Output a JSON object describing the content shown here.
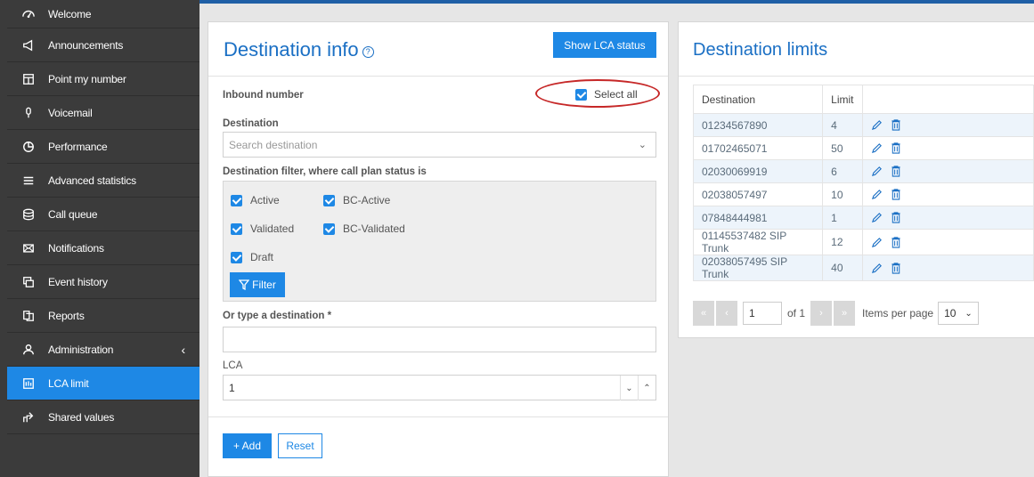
{
  "sidebar": {
    "items": [
      {
        "label": "Welcome",
        "icon": "tachometer-icon"
      },
      {
        "label": "Announcements",
        "icon": "megaphone-icon"
      },
      {
        "label": "Point my number",
        "icon": "layout-icon"
      },
      {
        "label": "Voicemail",
        "icon": "microphone-icon"
      },
      {
        "label": "Performance",
        "icon": "pie-chart-icon"
      },
      {
        "label": "Advanced statistics",
        "icon": "list-icon"
      },
      {
        "label": "Call queue",
        "icon": "database-icon"
      },
      {
        "label": "Notifications",
        "icon": "envelope-icon"
      },
      {
        "label": "Event history",
        "icon": "history-icon"
      },
      {
        "label": "Reports",
        "icon": "documents-icon"
      },
      {
        "label": "Administration",
        "icon": "user-icon"
      },
      {
        "label": "LCA limit",
        "icon": "lca-icon"
      },
      {
        "label": "Shared values",
        "icon": "share-icon"
      }
    ],
    "active_index": 11,
    "accent": "#1e88e5"
  },
  "destination_info": {
    "title": "Destination info",
    "show_lca_label": "Show LCA status",
    "inbound_label": "Inbound number",
    "select_all_label": "Select all",
    "destination_label": "Destination",
    "destination_placeholder": "Search destination",
    "filter_label": "Destination filter, where call plan status is",
    "filters": {
      "active": "Active",
      "bc_active": "BC-Active",
      "validated": "Validated",
      "bc_validated": "BC-Validated",
      "draft": "Draft"
    },
    "filter_button": "Filter",
    "type_dest_label": "Or type a destination *",
    "lca_label": "LCA",
    "lca_value": "1",
    "add_button": "+ Add",
    "reset_button": "Reset"
  },
  "destination_limits": {
    "title": "Destination limits",
    "columns": [
      "Destination",
      "Limit"
    ],
    "rows": [
      {
        "destination": "01234567890",
        "limit": "4"
      },
      {
        "destination": "01702465071",
        "limit": "50"
      },
      {
        "destination": "02030069919",
        "limit": "6"
      },
      {
        "destination": "02038057497",
        "limit": "10"
      },
      {
        "destination": "07848444981",
        "limit": "1"
      },
      {
        "destination": "01145537482 SIP Trunk",
        "limit": "12"
      },
      {
        "destination": "02038057495 SIP Trunk",
        "limit": "40"
      }
    ],
    "pager": {
      "page": "1",
      "of_label": "of 1",
      "items_per_page_label": "Items per page",
      "items_per_page": "10"
    }
  }
}
